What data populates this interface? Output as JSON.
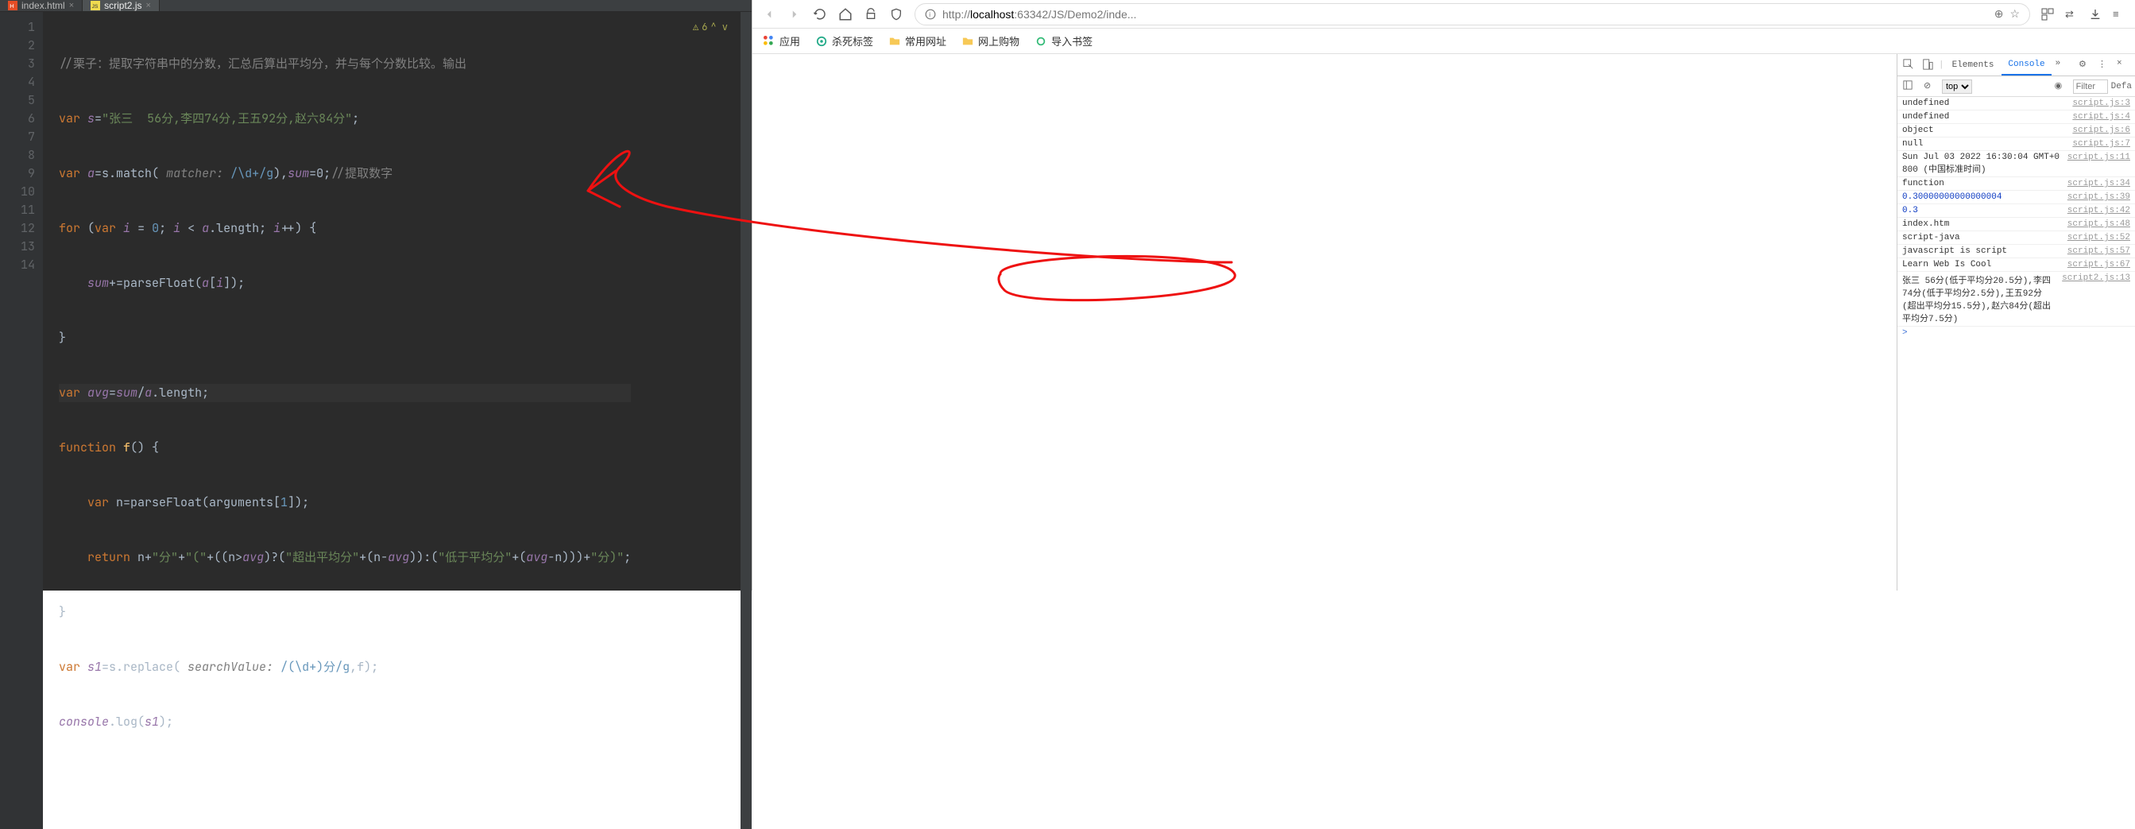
{
  "editor": {
    "tabs": [
      {
        "label": "index.html",
        "active": false
      },
      {
        "label": "script2.js",
        "active": true
      }
    ],
    "warning_count": "6",
    "line_numbers": [
      "1",
      "2",
      "3",
      "4",
      "5",
      "6",
      "7",
      "8",
      "9",
      "10",
      "11",
      "12",
      "13",
      "14"
    ],
    "code": {
      "l1": "//栗子：提取字符串中的分数，汇总后算出平均分，并与每个分数比较。输出",
      "l2_var": "var",
      "l2_s": "s",
      "l2_eq": "=",
      "l2_str": "\"张三  56分,李四74分,王五92分,赵六84分\"",
      "l2_semi": ";",
      "l3_var": "var",
      "l3_a": "a",
      "l3_eq": "=s.match( ",
      "l3_hint": "matcher:",
      "l3_regex": " /\\d+/g",
      "l3_rest": "),",
      "l3_sum": "sum",
      "l3_zero": "=0",
      "l3_semi": ";",
      "l3_cmt": "//提取数字",
      "l4_for": "for",
      "l4_open": " (",
      "l4_var": "var",
      "l4_i": " i ",
      "l4_eq": "= ",
      "l4_z": "0",
      "l4_semi1": "; ",
      "l4_i2": "i ",
      "l4_lt": "< ",
      "l4_a": "a",
      "l4_dot": ".length; ",
      "l4_i3": "i",
      "l4_inc": "++) {",
      "l5_sum": "sum",
      "l5_eq": "+=parseFloat(",
      "l5_a": "a",
      "l5_br": "[",
      "l5_i": "i",
      "l5_end": "]);",
      "l6": "}",
      "l7_var": "var",
      "l7_avg": " avg",
      "l7_eq": "=",
      "l7_sum": "sum",
      "l7_sl": "/",
      "l7_a": "a",
      "l7_len": ".length;",
      "l8_fn": "function",
      "l8_name": " f",
      "l8_par": "() {",
      "l9_var": "var",
      "l9_n": " n=parseFloat(arguments[",
      "l9_one": "1",
      "l9_end": "]);",
      "l10_ret": "return",
      "l10_a": " n+",
      "l10_s1": "\"分\"",
      "l10_b": "+",
      "l10_s2": "\"(\"",
      "l10_c": "+((n>",
      "l10_avg": "avg",
      "l10_d": ")?(",
      "l10_s3": "\"超出平均分\"",
      "l10_e": "+(n-",
      "l10_avg2": "avg",
      "l10_f": ")):(",
      "l10_s4": "\"低于平均分\"",
      "l10_g": "+(",
      "l10_avg3": "avg",
      "l10_h": "-n)))+",
      "l10_s5": "\"分)\"",
      "l10_semi": ";",
      "l11": "}",
      "l12_var": "var",
      "l12_s1": " s1",
      "l12_eq": "=s.replace( ",
      "l12_hint": "searchValue:",
      "l12_regex": " /(\\d+)分/g",
      "l12_rest": ",f);",
      "l13_con": "console",
      "l13_log": ".log(",
      "l13_s1": "s1",
      "l13_end": ");"
    }
  },
  "browser": {
    "url_prefix": "http://",
    "url_host": "localhost",
    "url_port_path": ":63342/JS/Demo2/inde...",
    "bookmarks": {
      "apps": "应用",
      "kill": "杀死标签",
      "common": "常用网址",
      "shop": "网上购物",
      "import": "导入书签"
    }
  },
  "devtools": {
    "tabs": {
      "elements": "Elements",
      "console": "Console"
    },
    "context": "top",
    "filter_ph": "Filter",
    "default_label": "Defa",
    "logs": [
      {
        "msg": "undefined",
        "src": "script.js:3"
      },
      {
        "msg": "undefined",
        "src": "script.js:4"
      },
      {
        "msg": "object",
        "src": "script.js:6"
      },
      {
        "msg": "null",
        "src": "script.js:7"
      },
      {
        "msg": "Sun Jul 03 2022 16:30:04 GMT+0800 (中国标准时间)",
        "src": "script.js:11"
      },
      {
        "msg": "function",
        "src": "script.js:34"
      },
      {
        "msg": "0.30000000000000004",
        "src": "script.js:39",
        "cls": "blue"
      },
      {
        "msg": "0.3",
        "src": "script.js:42",
        "cls": "blue"
      },
      {
        "msg": "index.htm",
        "src": "script.js:48"
      },
      {
        "msg": "script-java",
        "src": "script.js:52"
      },
      {
        "msg": "javascript is script",
        "src": "script.js:57"
      },
      {
        "msg": "Learn Web Is Cool",
        "src": "script.js:67"
      },
      {
        "msg": "张三  56分(低于平均分20.5分),李四74分(低于平均分2.5分),王五92分(超出平均分15.5分),赵六84分(超出平均分7.5分)",
        "src": "script2.js:13",
        "hl": true
      }
    ],
    "prompt": ">"
  }
}
